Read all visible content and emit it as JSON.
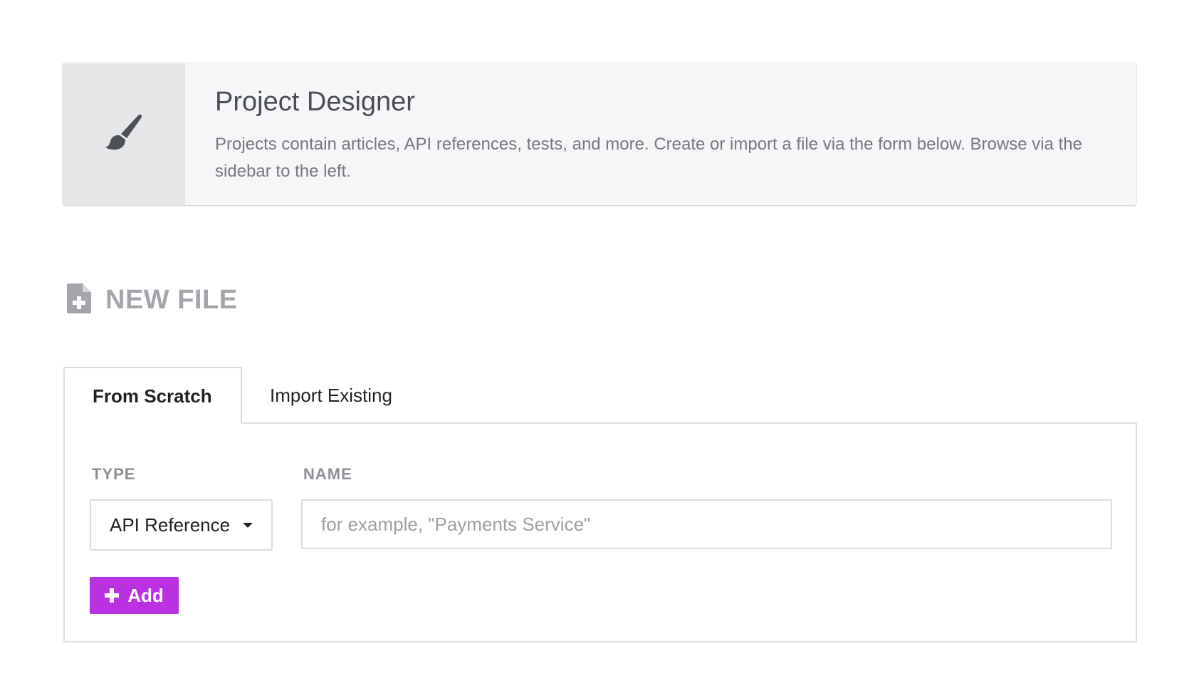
{
  "header": {
    "icon": "paintbrush-icon",
    "title": "Project Designer",
    "description": "Projects contain articles, API references, tests, and more. Create or import a file via the form below. Browse via the sidebar to the left."
  },
  "section": {
    "icon": "file-plus-icon",
    "title": "NEW FILE"
  },
  "tabs": [
    {
      "label": "From Scratch",
      "active": true
    },
    {
      "label": "Import Existing",
      "active": false
    }
  ],
  "form": {
    "type_label": "TYPE",
    "type_value": "API Reference",
    "name_label": "NAME",
    "name_value": "",
    "name_placeholder": "for example, \"Payments Service\"",
    "add_label": "Add"
  },
  "colors": {
    "accent": "#b931e0",
    "header_bg": "#f5f6f7",
    "header_icon_bg": "#e6e7e9",
    "muted_text": "#a3a5ab"
  }
}
